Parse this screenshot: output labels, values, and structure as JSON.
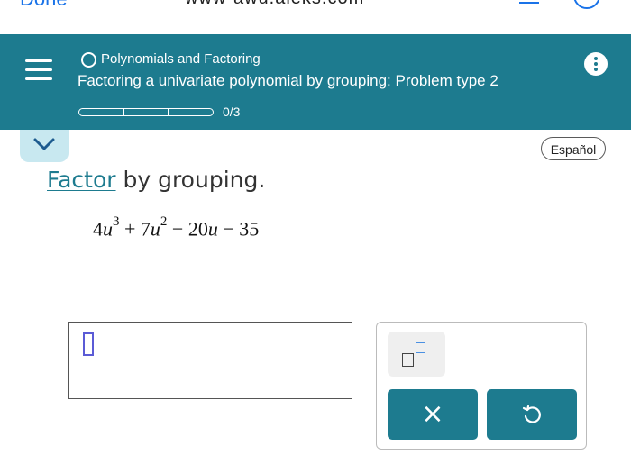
{
  "browser": {
    "done_label": "Done",
    "url": "www-awu.aleks.com"
  },
  "header": {
    "topic": "Polynomials and Factoring",
    "problem_title": "Factoring a univariate polynomial by grouping: Problem type 2",
    "progress_text": "0/3",
    "progress_completed": 0,
    "progress_total": 3,
    "background_color": "#1d7b8f"
  },
  "language_button": "Español",
  "instruction": {
    "link_word": "Factor",
    "rest": " by grouping."
  },
  "expression": {
    "t1_coef": "4",
    "t1_var": "u",
    "t1_exp": "3",
    "op1": " + ",
    "t2_coef": "7",
    "t2_var": "u",
    "t2_exp": "2",
    "op2": " − ",
    "t3": "20",
    "t3_var": "u",
    "op3": " − ",
    "t4": "35"
  },
  "tools": {
    "clear_glyph": "×",
    "icons": [
      "exponent-icon",
      "clear-icon",
      "undo-icon"
    ]
  },
  "colors": {
    "accent": "#1d7b8f",
    "link_blue": "#1a73e8",
    "collapse_tab": "#c8e8f0"
  }
}
